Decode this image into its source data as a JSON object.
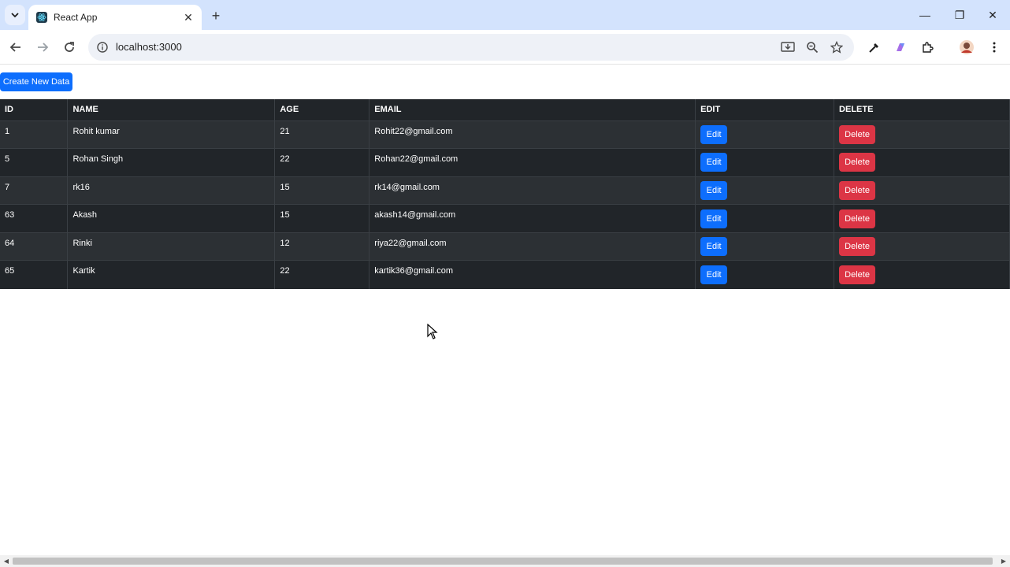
{
  "browser": {
    "tab_title": "React App",
    "url": "localhost:3000",
    "tab_close_glyph": "✕",
    "new_tab_glyph": "+",
    "window_controls": {
      "minimize": "—",
      "restore": "❐",
      "close": "✕"
    },
    "icons": [
      "tab-search-icon",
      "react-favicon-icon",
      "back-arrow-icon",
      "forward-arrow-icon",
      "reload-icon",
      "site-info-icon",
      "install-app-icon",
      "zoom-icon",
      "bookmark-star-icon",
      "eyedropper-icon",
      "gemini-icon",
      "extensions-icon",
      "profile-avatar-icon",
      "kebab-menu-icon"
    ]
  },
  "page": {
    "create_button": "Create New Data",
    "table": {
      "headers": {
        "id": "ID",
        "name": "NAME",
        "age": "AGE",
        "email": "EMAIL",
        "edit": "EDIT",
        "delete": "DELETE"
      },
      "edit_label": "Edit",
      "delete_label": "Delete",
      "rows": [
        {
          "id": "1",
          "name": "Rohit kumar",
          "age": "21",
          "email": "Rohit22@gmail.com"
        },
        {
          "id": "5",
          "name": "Rohan Singh",
          "age": "22",
          "email": "Rohan22@gmail.com"
        },
        {
          "id": "7",
          "name": "rk16",
          "age": "15",
          "email": "rk14@gmail.com"
        },
        {
          "id": "63",
          "name": "Akash",
          "age": "15",
          "email": "akash14@gmail.com"
        },
        {
          "id": "64",
          "name": "Rinki",
          "age": "12",
          "email": "riya22@gmail.com"
        },
        {
          "id": "65",
          "name": "Kartik",
          "age": "22",
          "email": "kartik36@gmail.com"
        }
      ]
    }
  },
  "colors": {
    "primary": "#0d6efd",
    "danger": "#dc3545",
    "table_dark": "#212529",
    "table_stripe": "#2c3034",
    "tabbar": "#d3e3fd"
  }
}
